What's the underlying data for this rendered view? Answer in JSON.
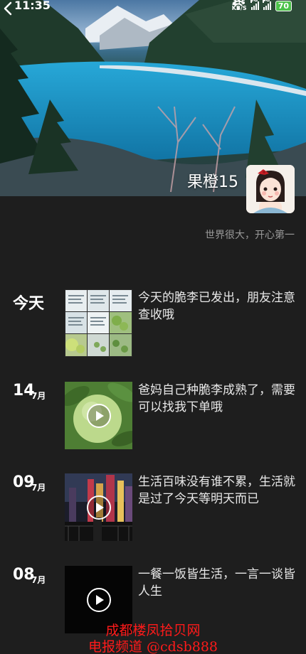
{
  "status_bar": {
    "time": "11:35",
    "net_speed_value": "215",
    "net_speed_unit": "KB/S",
    "signal_1_label": "5G",
    "signal_2_label": "4G",
    "battery": "70"
  },
  "profile": {
    "name": "果橙15",
    "bio": "世界很大，开心第一"
  },
  "feed": [
    {
      "date_text": "今天",
      "day": "",
      "month": "",
      "caption": "今天的脆李已发出，朋友注意查收哦",
      "has_video": false
    },
    {
      "date_text": "",
      "day": "14",
      "month": "7月",
      "caption": "爸妈自己种脆李成熟了，需要可以找我下单哦",
      "has_video": true
    },
    {
      "date_text": "",
      "day": "09",
      "month": "7月",
      "caption": "生活百味没有谁不累，生活就是过了今天等明天而已",
      "has_video": true
    },
    {
      "date_text": "",
      "day": "08",
      "month": "7月",
      "caption": "一餐一饭皆生活，一言一谈皆人生",
      "has_video": true
    }
  ],
  "watermark": {
    "line1": "成都楼凤拾贝网",
    "line2": "电报频道 @cdsb888"
  }
}
